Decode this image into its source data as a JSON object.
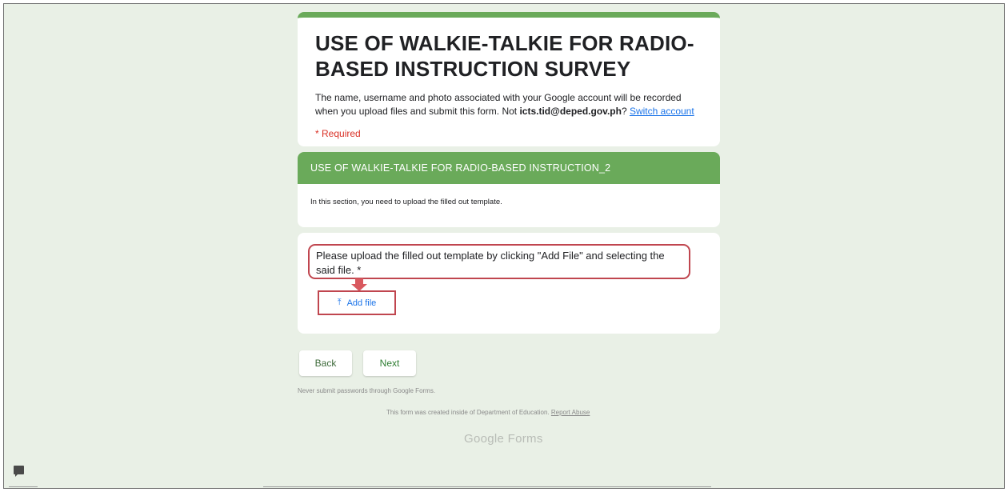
{
  "form": {
    "title": "USE OF WALKIE-TALKIE FOR RADIO-BASED INSTRUCTION SURVEY",
    "description_prefix": "The name, username and photo associated with your Google account will be recorded when you upload files and submit this form. Not ",
    "account_email": "icts.tid@deped.gov.ph",
    "description_suffix": "? ",
    "switch_account_label": "Switch account",
    "required_label": "* Required"
  },
  "section": {
    "title": "USE OF WALKIE-TALKIE FOR RADIO-BASED INSTRUCTION_2",
    "description": "In this section, you need to upload the filled out template."
  },
  "question": {
    "text": "Please upload the filled out template by clicking \"Add File\" and selecting the said file. *",
    "add_file_label": "Add file",
    "add_file_icon": "upload-icon"
  },
  "navigation": {
    "back_label": "Back",
    "next_label": "Next"
  },
  "footer": {
    "warning": "Never submit passwords through Google Forms.",
    "created_text": "This form was created inside of Department of Education. ",
    "report_abuse_label": "Report Abuse",
    "logo_text": "Google Forms"
  },
  "colors": {
    "theme_green": "#6aaa5a",
    "background": "#e9f0e6",
    "annotation_red": "#c0464f",
    "link_blue": "#1a73e8"
  }
}
